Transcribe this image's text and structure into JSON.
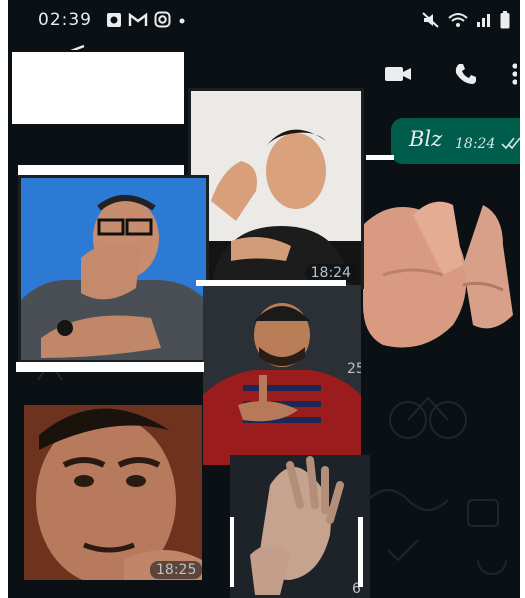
{
  "status_bar": {
    "time": "02:39",
    "left_icons": [
      "notification-icon",
      "gmail-icon",
      "instagram-icon",
      "dot-icon"
    ],
    "right_icons": [
      "mute-icon",
      "wifi-icon",
      "signal-icon",
      "battery-icon"
    ]
  },
  "app_bar": {
    "actions": [
      "video-call-icon",
      "voice-call-icon",
      "more-options-icon"
    ]
  },
  "messages": {
    "outgoing": {
      "text": "Blz",
      "time": "18:24"
    },
    "stickers": [
      {
        "name": "sticker-man-white-wall",
        "time": "18:24"
      },
      {
        "name": "sticker-man-glasses-blue-wall",
        "time": ""
      },
      {
        "name": "sticker-hands-right",
        "time": ""
      },
      {
        "name": "sticker-man-striped-shirt",
        "time": "25"
      },
      {
        "name": "sticker-man-closeup",
        "time": "18:25"
      },
      {
        "name": "sticker-hands-gesture",
        "time": "6"
      }
    ]
  },
  "colors": {
    "chat_background": "#0b1014",
    "outgoing_bubble": "#005c4b",
    "status_text": "#e9edef"
  }
}
